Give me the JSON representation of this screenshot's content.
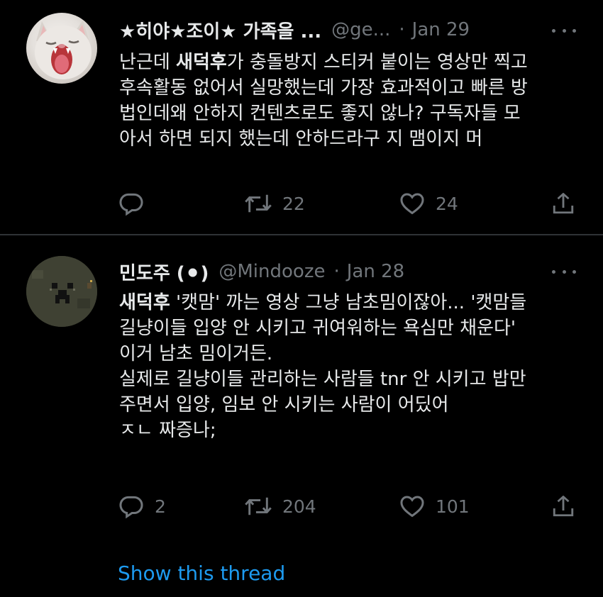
{
  "colors": {
    "background": "#000000",
    "text_primary": "#e7e9ea",
    "text_secondary": "#71767b",
    "link": "#1d9bf0",
    "divider": "#2f3336"
  },
  "tweets": [
    {
      "display_name": "★히야★조이★ 가족을 ...",
      "handle": "@ge...",
      "separator": "·",
      "date": "Jan 29",
      "avatar_icon": "cat-yawning-avatar",
      "text_lines": [
        {
          "prefix": "난근데 ",
          "bold": "새덕후",
          "suffix": "가 충돌방지 스티커 붙이는 영상만 찍고"
        },
        {
          "prefix": "후속활동 없어서 실망했는데 가장 효과적이고 빠른 방",
          "bold": "",
          "suffix": ""
        },
        {
          "prefix": "법인데왜 안하지 컨텐츠로도 좋지 않나? 구독자들 모",
          "bold": "",
          "suffix": ""
        },
        {
          "prefix": "아서 하면 되지 했는데 안하드라구 지 맴이지 머",
          "bold": "",
          "suffix": ""
        }
      ],
      "reply_count": "",
      "retweet_count": "22",
      "like_count": "24"
    },
    {
      "display_name": "민도주 (⚫)",
      "handle": "@Mindooze",
      "separator": "·",
      "date": "Jan 28",
      "avatar_icon": "pixel-face-avatar",
      "text_lines": [
        {
          "prefix": "",
          "bold": "새덕후",
          "suffix": " '캣맘' 까는 영상 그냥 남초밈이잖아... '캣맘들"
        },
        {
          "prefix": "길냥이들 입양 안 시키고 귀여워하는 욕심만 채운다'",
          "bold": "",
          "suffix": ""
        },
        {
          "prefix": "이거 남초 밈이거든.",
          "bold": "",
          "suffix": ""
        },
        {
          "prefix": "실제로 길냥이들 관리하는 사람들 tnr 안 시키고 밥만",
          "bold": "",
          "suffix": ""
        },
        {
          "prefix": "주면서 입양, 임보 안 시키는 사람이 어딨어",
          "bold": "",
          "suffix": ""
        },
        {
          "prefix": "ㅈㄴ 짜증나;",
          "bold": "",
          "suffix": ""
        }
      ],
      "reply_count": "2",
      "retweet_count": "204",
      "like_count": "101"
    }
  ],
  "show_thread_label": "Show this thread"
}
